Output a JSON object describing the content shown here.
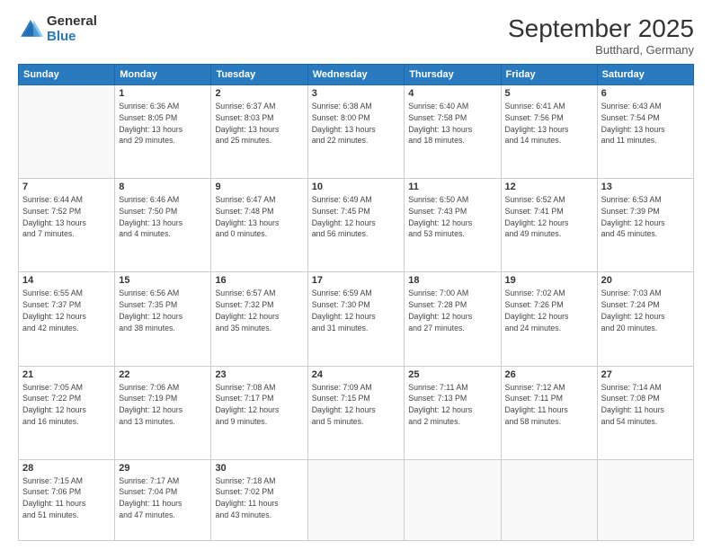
{
  "header": {
    "logo_general": "General",
    "logo_blue": "Blue",
    "month_title": "September 2025",
    "location": "Butthard, Germany"
  },
  "days_of_week": [
    "Sunday",
    "Monday",
    "Tuesday",
    "Wednesday",
    "Thursday",
    "Friday",
    "Saturday"
  ],
  "weeks": [
    [
      {
        "day": "",
        "info": ""
      },
      {
        "day": "1",
        "info": "Sunrise: 6:36 AM\nSunset: 8:05 PM\nDaylight: 13 hours\nand 29 minutes."
      },
      {
        "day": "2",
        "info": "Sunrise: 6:37 AM\nSunset: 8:03 PM\nDaylight: 13 hours\nand 25 minutes."
      },
      {
        "day": "3",
        "info": "Sunrise: 6:38 AM\nSunset: 8:00 PM\nDaylight: 13 hours\nand 22 minutes."
      },
      {
        "day": "4",
        "info": "Sunrise: 6:40 AM\nSunset: 7:58 PM\nDaylight: 13 hours\nand 18 minutes."
      },
      {
        "day": "5",
        "info": "Sunrise: 6:41 AM\nSunset: 7:56 PM\nDaylight: 13 hours\nand 14 minutes."
      },
      {
        "day": "6",
        "info": "Sunrise: 6:43 AM\nSunset: 7:54 PM\nDaylight: 13 hours\nand 11 minutes."
      }
    ],
    [
      {
        "day": "7",
        "info": "Sunrise: 6:44 AM\nSunset: 7:52 PM\nDaylight: 13 hours\nand 7 minutes."
      },
      {
        "day": "8",
        "info": "Sunrise: 6:46 AM\nSunset: 7:50 PM\nDaylight: 13 hours\nand 4 minutes."
      },
      {
        "day": "9",
        "info": "Sunrise: 6:47 AM\nSunset: 7:48 PM\nDaylight: 13 hours\nand 0 minutes."
      },
      {
        "day": "10",
        "info": "Sunrise: 6:49 AM\nSunset: 7:45 PM\nDaylight: 12 hours\nand 56 minutes."
      },
      {
        "day": "11",
        "info": "Sunrise: 6:50 AM\nSunset: 7:43 PM\nDaylight: 12 hours\nand 53 minutes."
      },
      {
        "day": "12",
        "info": "Sunrise: 6:52 AM\nSunset: 7:41 PM\nDaylight: 12 hours\nand 49 minutes."
      },
      {
        "day": "13",
        "info": "Sunrise: 6:53 AM\nSunset: 7:39 PM\nDaylight: 12 hours\nand 45 minutes."
      }
    ],
    [
      {
        "day": "14",
        "info": "Sunrise: 6:55 AM\nSunset: 7:37 PM\nDaylight: 12 hours\nand 42 minutes."
      },
      {
        "day": "15",
        "info": "Sunrise: 6:56 AM\nSunset: 7:35 PM\nDaylight: 12 hours\nand 38 minutes."
      },
      {
        "day": "16",
        "info": "Sunrise: 6:57 AM\nSunset: 7:32 PM\nDaylight: 12 hours\nand 35 minutes."
      },
      {
        "day": "17",
        "info": "Sunrise: 6:59 AM\nSunset: 7:30 PM\nDaylight: 12 hours\nand 31 minutes."
      },
      {
        "day": "18",
        "info": "Sunrise: 7:00 AM\nSunset: 7:28 PM\nDaylight: 12 hours\nand 27 minutes."
      },
      {
        "day": "19",
        "info": "Sunrise: 7:02 AM\nSunset: 7:26 PM\nDaylight: 12 hours\nand 24 minutes."
      },
      {
        "day": "20",
        "info": "Sunrise: 7:03 AM\nSunset: 7:24 PM\nDaylight: 12 hours\nand 20 minutes."
      }
    ],
    [
      {
        "day": "21",
        "info": "Sunrise: 7:05 AM\nSunset: 7:22 PM\nDaylight: 12 hours\nand 16 minutes."
      },
      {
        "day": "22",
        "info": "Sunrise: 7:06 AM\nSunset: 7:19 PM\nDaylight: 12 hours\nand 13 minutes."
      },
      {
        "day": "23",
        "info": "Sunrise: 7:08 AM\nSunset: 7:17 PM\nDaylight: 12 hours\nand 9 minutes."
      },
      {
        "day": "24",
        "info": "Sunrise: 7:09 AM\nSunset: 7:15 PM\nDaylight: 12 hours\nand 5 minutes."
      },
      {
        "day": "25",
        "info": "Sunrise: 7:11 AM\nSunset: 7:13 PM\nDaylight: 12 hours\nand 2 minutes."
      },
      {
        "day": "26",
        "info": "Sunrise: 7:12 AM\nSunset: 7:11 PM\nDaylight: 11 hours\nand 58 minutes."
      },
      {
        "day": "27",
        "info": "Sunrise: 7:14 AM\nSunset: 7:08 PM\nDaylight: 11 hours\nand 54 minutes."
      }
    ],
    [
      {
        "day": "28",
        "info": "Sunrise: 7:15 AM\nSunset: 7:06 PM\nDaylight: 11 hours\nand 51 minutes."
      },
      {
        "day": "29",
        "info": "Sunrise: 7:17 AM\nSunset: 7:04 PM\nDaylight: 11 hours\nand 47 minutes."
      },
      {
        "day": "30",
        "info": "Sunrise: 7:18 AM\nSunset: 7:02 PM\nDaylight: 11 hours\nand 43 minutes."
      },
      {
        "day": "",
        "info": ""
      },
      {
        "day": "",
        "info": ""
      },
      {
        "day": "",
        "info": ""
      },
      {
        "day": "",
        "info": ""
      }
    ]
  ]
}
